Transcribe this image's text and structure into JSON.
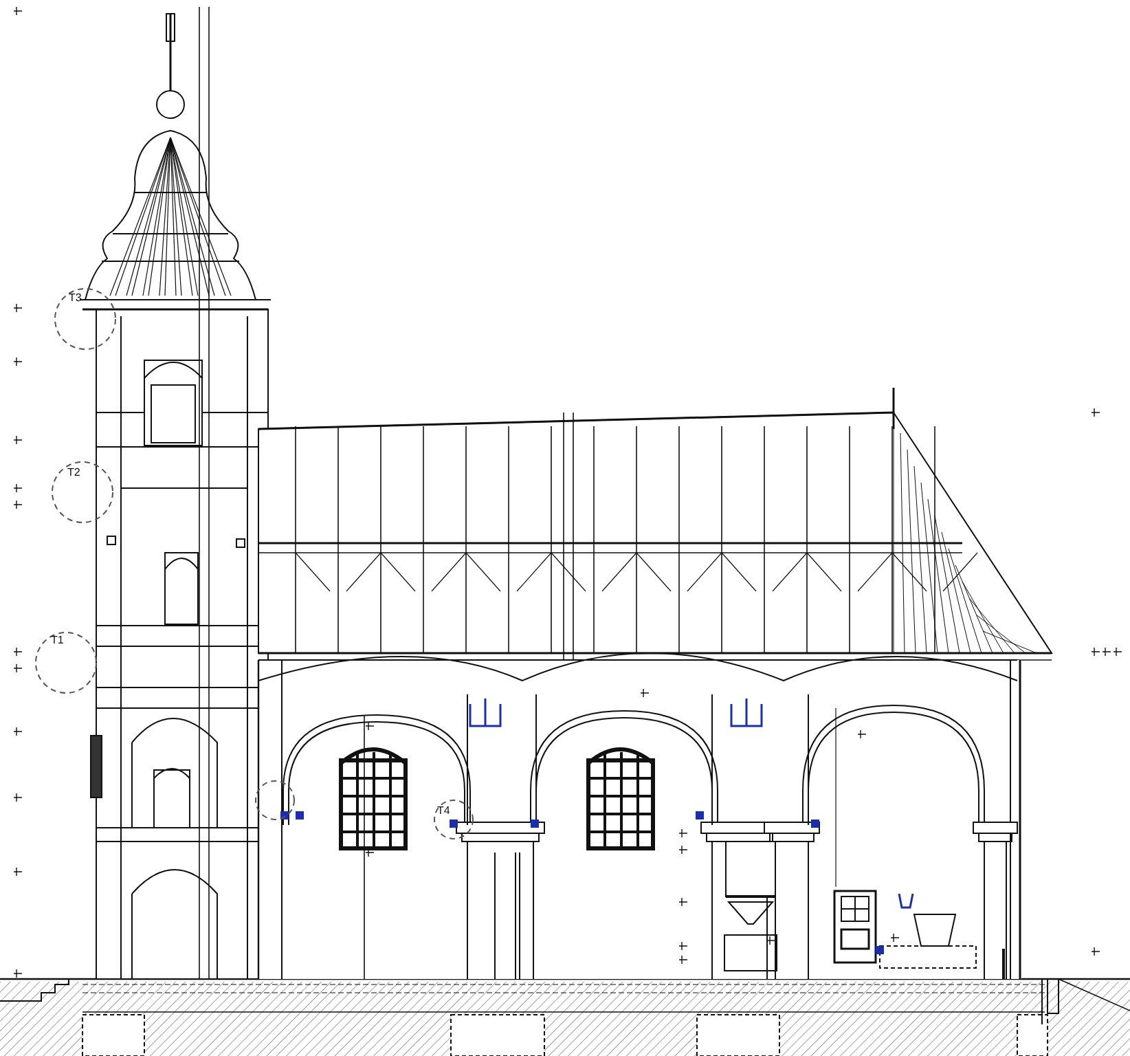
{
  "drawing": {
    "detail_callouts": [
      {
        "label": "T3"
      },
      {
        "label": "T2"
      },
      {
        "label": "T1"
      },
      {
        "label": "T4"
      }
    ]
  }
}
